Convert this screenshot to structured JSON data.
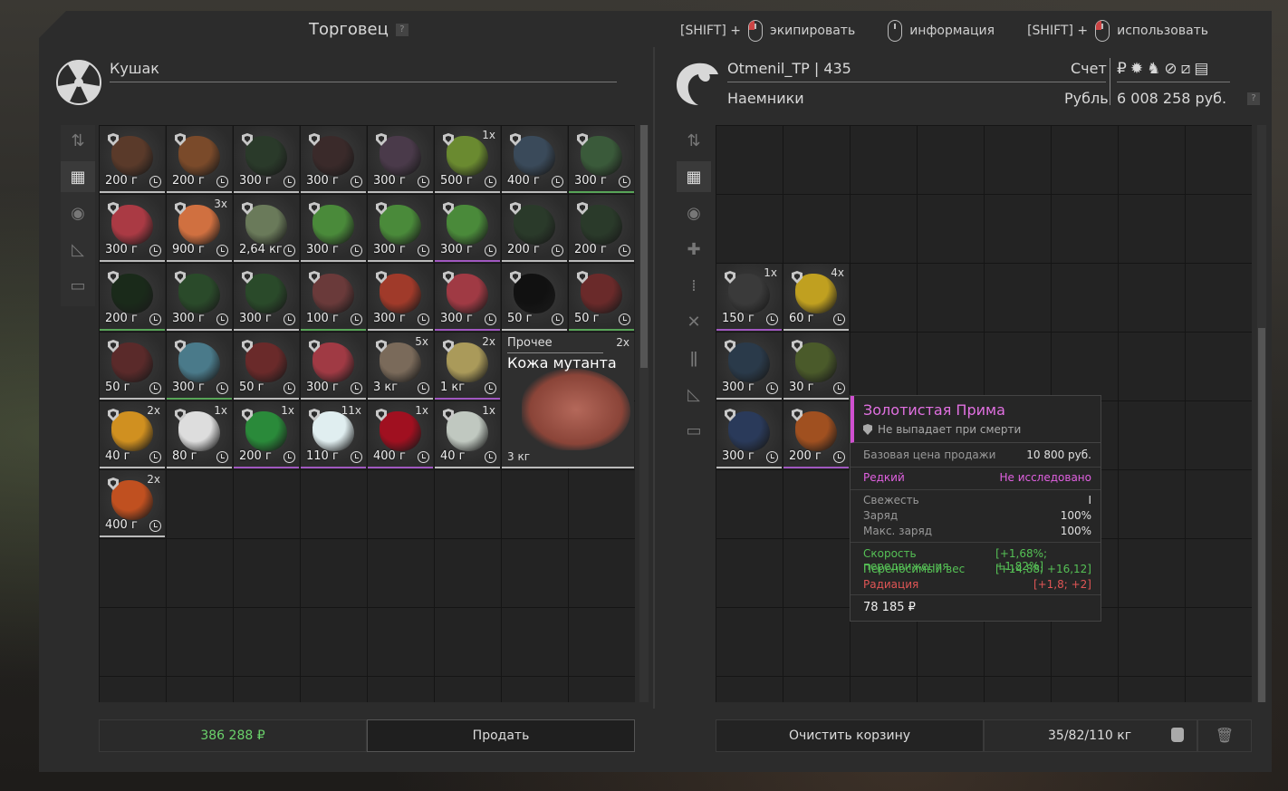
{
  "window": {
    "title": "Торговец"
  },
  "hints": [
    {
      "prefix": "[SHIFT] +",
      "action": "экипировать"
    },
    {
      "prefix": "",
      "action": "информация"
    },
    {
      "prefix": "[SHIFT] +",
      "action": "использовать"
    }
  ],
  "trader": {
    "name": "Кушак"
  },
  "player": {
    "name": "Otmenil_TP | 435",
    "faction": "Наемники",
    "account_label": "Счет",
    "currency_label": "Рубль",
    "balance": "6 008 258 руб."
  },
  "left_items": [
    {
      "price": "200 г",
      "qty": "",
      "color": "#5a3a2a",
      "rarity": "w"
    },
    {
      "price": "200 г",
      "qty": "",
      "color": "#7a4a2a",
      "rarity": "w"
    },
    {
      "price": "300 г",
      "qty": "",
      "color": "#2a3a2a",
      "rarity": "w"
    },
    {
      "price": "300 г",
      "qty": "",
      "color": "#3a2a2a",
      "rarity": "w"
    },
    {
      "price": "300 г",
      "qty": "",
      "color": "#4a3a4a",
      "rarity": "w"
    },
    {
      "price": "500 г",
      "qty": "1x",
      "color": "#6a8a30",
      "rarity": "w"
    },
    {
      "price": "400 г",
      "qty": "",
      "color": "#3a4a5a",
      "rarity": "w"
    },
    {
      "price": "300 г",
      "qty": "",
      "color": "#3a5a3a",
      "rarity": "g"
    },
    {
      "price": "300 г",
      "qty": "",
      "color": "#aa3a44",
      "rarity": "w"
    },
    {
      "price": "900 г",
      "qty": "3x",
      "color": "#d07040",
      "rarity": "w"
    },
    {
      "price": "2,64 кг",
      "qty": "",
      "color": "#6a7a5a",
      "rarity": "w"
    },
    {
      "price": "300 г",
      "qty": "",
      "color": "#4a8a3a",
      "rarity": "w"
    },
    {
      "price": "300 г",
      "qty": "",
      "color": "#4a8a3a",
      "rarity": "w"
    },
    {
      "price": "300 г",
      "qty": "",
      "color": "#4a8a3a",
      "rarity": "p"
    },
    {
      "price": "200 г",
      "qty": "",
      "color": "#2a3a2a",
      "rarity": "w"
    },
    {
      "price": "200 г",
      "qty": "",
      "color": "#2a3a2a",
      "rarity": "w"
    },
    {
      "price": "200 г",
      "qty": "",
      "color": "#1a2a1a",
      "rarity": "g"
    },
    {
      "price": "300 г",
      "qty": "",
      "color": "#2a4a2a",
      "rarity": "w"
    },
    {
      "price": "300 г",
      "qty": "",
      "color": "#2a4a2a",
      "rarity": "w"
    },
    {
      "price": "100 г",
      "qty": "",
      "color": "#6a3a3a",
      "rarity": "g"
    },
    {
      "price": "300 г",
      "qty": "",
      "color": "#a03a2a",
      "rarity": "w"
    },
    {
      "price": "300 г",
      "qty": "",
      "color": "#a03a44",
      "rarity": "p"
    },
    {
      "price": "50 г",
      "qty": "",
      "color": "#111111",
      "rarity": "w"
    },
    {
      "price": "50 г",
      "qty": "",
      "color": "#6a2a2a",
      "rarity": "g"
    },
    {
      "price": "50 г",
      "qty": "",
      "color": "#5a2a2a",
      "rarity": "w"
    },
    {
      "price": "300 г",
      "qty": "",
      "color": "#4a7a8a",
      "rarity": "g"
    },
    {
      "price": "50 г",
      "qty": "",
      "color": "#6a2a2a",
      "rarity": "w"
    },
    {
      "price": "300 г",
      "qty": "",
      "color": "#a03a44",
      "rarity": "w"
    },
    {
      "price": "3 кг",
      "qty": "5x",
      "color": "#7a6a5a",
      "rarity": "w"
    },
    {
      "price": "1 кг",
      "qty": "2x",
      "color": "#aa9a5a",
      "rarity": "p"
    },
    {
      "price": "40 г",
      "qty": "2x",
      "color": "#d09020",
      "rarity": "w"
    },
    {
      "price": "80 г",
      "qty": "1x",
      "color": "#dddddd",
      "rarity": "w"
    },
    {
      "price": "200 г",
      "qty": "1x",
      "color": "#2a8a3a",
      "rarity": "p"
    },
    {
      "price": "110 г",
      "qty": "11x",
      "color": "#e0eef0",
      "rarity": "p"
    },
    {
      "price": "400 г",
      "qty": "1x",
      "color": "#a01020",
      "rarity": "p"
    },
    {
      "price": "40 г",
      "qty": "1x",
      "color": "#c0c8c0",
      "rarity": "w"
    },
    {
      "price": "400 г",
      "qty": "2x",
      "color": "#c05020",
      "rarity": "w"
    }
  ],
  "big_item": {
    "category": "Прочее",
    "qty": "2x",
    "name": "Кожа мутанта",
    "weight": "3 кг"
  },
  "right_items": [
    {
      "price": "150 г",
      "qty": "1x",
      "color": "#3a3a3a",
      "rarity": "p"
    },
    {
      "price": "60 г",
      "qty": "4x",
      "color": "#c0a020",
      "rarity": "w"
    },
    {
      "price": "300 г",
      "qty": "",
      "color": "#2a3a4a",
      "rarity": "w"
    },
    {
      "price": "30 г",
      "qty": "",
      "color": "#4a5a2a",
      "rarity": "w"
    },
    {
      "price": "300 г",
      "qty": "",
      "color": "#2a3a5a",
      "rarity": "w"
    },
    {
      "price": "200 г",
      "qty": "",
      "color": "#a05020",
      "rarity": "p"
    }
  ],
  "tooltip": {
    "title": "Золотистая Прима",
    "subtitle": "Не выпадает при смерти",
    "base_price_label": "Базовая цена продажи",
    "base_price": "10 800 руб.",
    "rarity": "Редкий",
    "research": "Не исследовано",
    "freshness_label": "Свежесть",
    "freshness": "I",
    "charge_label": "Заряд",
    "charge": "100%",
    "max_charge_label": "Макс. заряд",
    "max_charge": "100%",
    "speed_label": "Скорость передвижения",
    "speed": "[+1,68%; +1,82%]",
    "carry_label": "Переносимый вес",
    "carry": "[+14,88; +16,12]",
    "radiation_label": "Радиация",
    "radiation": "[+1,8; +2]",
    "price": "78 185 ₽"
  },
  "footer": {
    "total": "386 288 ₽",
    "sell": "Продать",
    "clear": "Очистить корзину",
    "weight": "35/82/110 кг"
  }
}
